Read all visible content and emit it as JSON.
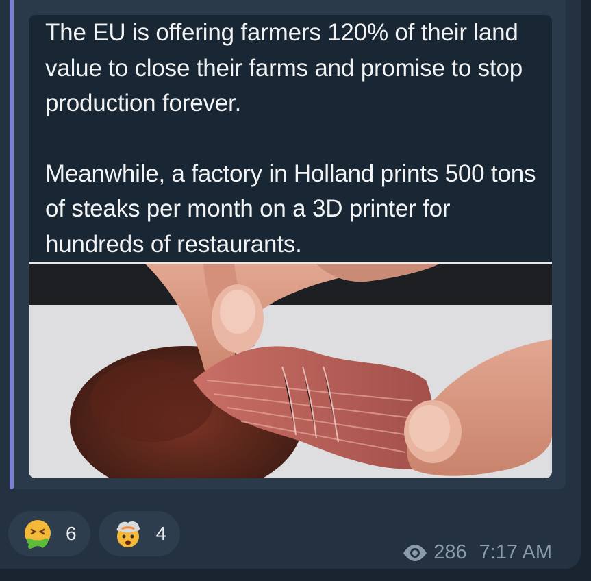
{
  "post": {
    "paragraph_1": "The EU is offering farmers 120% of their land value to close their farms and promise to stop production forever.",
    "paragraph_2": "Meanwhile, a factory in Holland prints 500 tons of steaks per month on a 3D printer for hundreds of restaurants."
  },
  "reactions": [
    {
      "icon": "nauseated-face-icon",
      "count": "6"
    },
    {
      "icon": "exploding-head-icon",
      "count": "4"
    }
  ],
  "meta": {
    "views": "286",
    "time": "7:17 AM",
    "views_icon": "eye-icon"
  },
  "colors": {
    "quote_accent": "#7c7fd6",
    "bubble": "#233140",
    "text": "#f2f3f5",
    "meta_text": "#8a9aab"
  }
}
